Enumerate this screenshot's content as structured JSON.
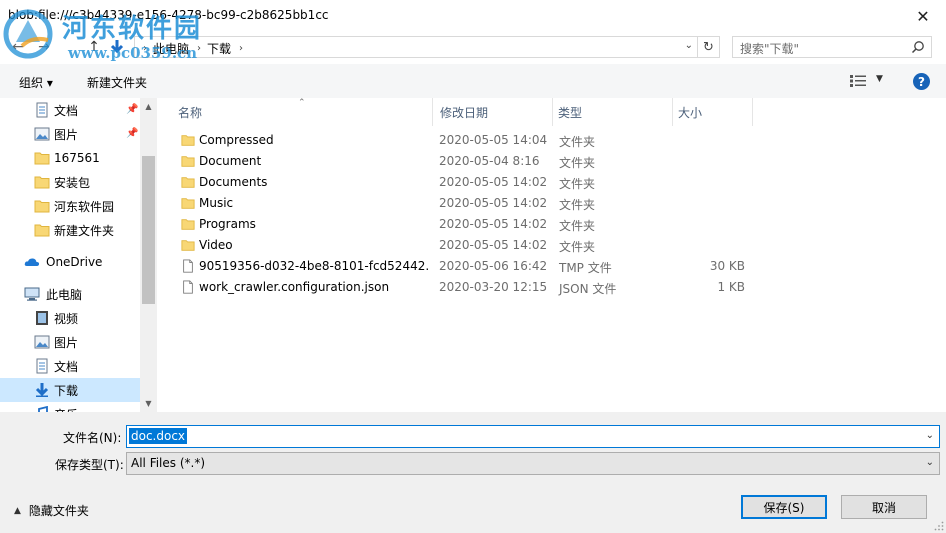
{
  "window": {
    "title": "blob:file:///c3b44339-e156-4278-bc99-c2b8625bb1cc",
    "close_glyph": "✕"
  },
  "watermark": {
    "name": "河东软件园",
    "url": "www.pc0359.cn"
  },
  "navigation": {
    "back_glyph": "←",
    "forward_glyph": "→",
    "up_glyph": "↑",
    "address_crumbs": [
      "此电脑",
      "下载"
    ],
    "search_placeholder": "搜索\"下载\""
  },
  "toolbar": {
    "organize_label": "组织 ▾",
    "new_folder_label": "新建文件夹",
    "help_label": "?"
  },
  "sidebar": {
    "items": [
      {
        "label": "文档",
        "icon": "document-icon",
        "pinned": true
      },
      {
        "label": "图片",
        "icon": "picture-icon",
        "pinned": true
      },
      {
        "label": "167561",
        "icon": "folder-icon",
        "pinned": false
      },
      {
        "label": "安装包",
        "icon": "folder-icon",
        "pinned": false
      },
      {
        "label": "河东软件园",
        "icon": "folder-icon",
        "pinned": false
      },
      {
        "label": "新建文件夹",
        "icon": "folder-icon",
        "pinned": false
      },
      {
        "label": "OneDrive",
        "icon": "cloud-icon",
        "pinned": false
      },
      {
        "label": "此电脑",
        "icon": "computer-icon",
        "pinned": false
      },
      {
        "label": "视频",
        "icon": "video-icon",
        "pinned": false
      },
      {
        "label": "图片",
        "icon": "picture-icon",
        "pinned": false
      },
      {
        "label": "文档",
        "icon": "document-icon",
        "pinned": false
      },
      {
        "label": "下载",
        "icon": "download-icon",
        "pinned": false,
        "selected": true
      },
      {
        "label": "音乐",
        "icon": "music-icon",
        "pinned": false
      }
    ]
  },
  "filelist": {
    "columns": [
      "名称",
      "修改日期",
      "类型",
      "大小"
    ],
    "rows": [
      {
        "name": "Compressed",
        "date": "2020-05-05 14:04",
        "type": "文件夹",
        "size": "",
        "icon": "folder-icon"
      },
      {
        "name": "Document",
        "date": "2020-05-04 8:16",
        "type": "文件夹",
        "size": "",
        "icon": "folder-icon"
      },
      {
        "name": "Documents",
        "date": "2020-05-05 14:02",
        "type": "文件夹",
        "size": "",
        "icon": "folder-icon"
      },
      {
        "name": "Music",
        "date": "2020-05-05 14:02",
        "type": "文件夹",
        "size": "",
        "icon": "folder-icon"
      },
      {
        "name": "Programs",
        "date": "2020-05-05 14:02",
        "type": "文件夹",
        "size": "",
        "icon": "folder-icon"
      },
      {
        "name": "Video",
        "date": "2020-05-05 14:02",
        "type": "文件夹",
        "size": "",
        "icon": "folder-icon"
      },
      {
        "name": "90519356-d032-4be8-8101-fcd52442...",
        "date": "2020-05-06 16:42",
        "type": "TMP 文件",
        "size": "30 KB",
        "icon": "file-icon"
      },
      {
        "name": "work_crawler.configuration.json",
        "date": "2020-03-20 12:15",
        "type": "JSON 文件",
        "size": "1 KB",
        "icon": "file-icon"
      }
    ]
  },
  "save_form": {
    "filename_label": "文件名(N):",
    "filename_value": "doc.docx",
    "filetype_label": "保存类型(T):",
    "filetype_value": "All Files (*.*)",
    "hide_folders_label": "隐藏文件夹",
    "save_button": "保存(S)",
    "cancel_button": "取消"
  },
  "colors": {
    "accent": "#0078d7",
    "folder": "#f8d775",
    "selection": "#cce8ff"
  }
}
